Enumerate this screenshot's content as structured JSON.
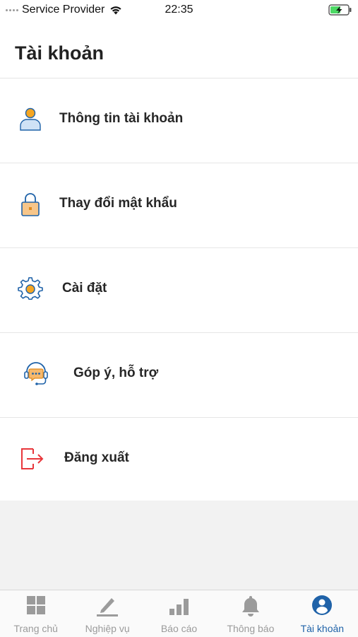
{
  "status_bar": {
    "carrier": "Service Provider",
    "time": "22:35"
  },
  "header": {
    "title": "Tài khoản"
  },
  "menu": {
    "items": [
      {
        "label": "Thông tin tài khoản",
        "icon": "user-icon"
      },
      {
        "label": "Thay đổi mật khẩu",
        "icon": "lock-icon"
      },
      {
        "label": "Cài đặt",
        "icon": "gear-icon"
      },
      {
        "label": "Góp ý, hỗ trợ",
        "icon": "support-chat-icon"
      },
      {
        "label": "Đăng xuất",
        "icon": "logout-icon"
      }
    ]
  },
  "tabbar": {
    "tabs": [
      {
        "label": "Trang chủ",
        "icon": "grid-icon",
        "active": false
      },
      {
        "label": "Nghiệp vụ",
        "icon": "pencil-icon",
        "active": false
      },
      {
        "label": "Báo cáo",
        "icon": "bar-chart-icon",
        "active": false
      },
      {
        "label": "Thông báo",
        "icon": "bell-icon",
        "active": false
      },
      {
        "label": "Tài khoản",
        "icon": "account-icon",
        "active": true
      }
    ]
  },
  "colors": {
    "accent_blue": "#1f62a8",
    "icon_orange": "#f5a623",
    "logout_red": "#e8363b",
    "inactive_gray": "#9b9b9b"
  }
}
